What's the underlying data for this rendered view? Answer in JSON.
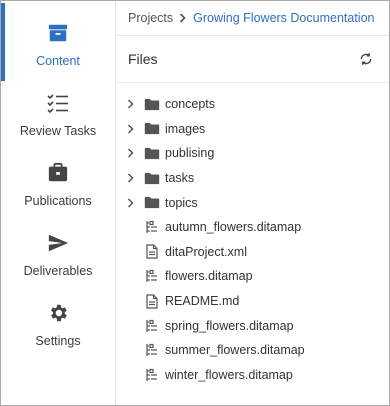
{
  "sidebar": {
    "items": [
      {
        "label": "Content",
        "icon": "archive-icon",
        "active": true
      },
      {
        "label": "Review Tasks",
        "icon": "checklist-icon"
      },
      {
        "label": "Publications",
        "icon": "briefcase-icon"
      },
      {
        "label": "Deliverables",
        "icon": "send-icon"
      },
      {
        "label": "Settings",
        "icon": "gear-icon"
      }
    ]
  },
  "breadcrumb": {
    "root": "Projects",
    "separator_icon": "chevron-right-icon",
    "current": "Growing Flowers Documentation"
  },
  "files_panel": {
    "title": "Files",
    "refresh_icon": "refresh-icon",
    "folders": [
      {
        "name": "concepts"
      },
      {
        "name": "images"
      },
      {
        "name": "publising"
      },
      {
        "name": "tasks"
      },
      {
        "name": "topics"
      }
    ],
    "files": [
      {
        "name": "autumn_flowers.ditamap",
        "icon": "map-icon"
      },
      {
        "name": "ditaProject.xml",
        "icon": "file-icon"
      },
      {
        "name": "flowers.ditamap",
        "icon": "map-icon"
      },
      {
        "name": "README.md",
        "icon": "file-icon"
      },
      {
        "name": "spring_flowers.ditamap",
        "icon": "map-icon"
      },
      {
        "name": "summer_flowers.ditamap",
        "icon": "map-icon"
      },
      {
        "name": "winter_flowers.ditamap",
        "icon": "map-icon"
      }
    ]
  },
  "colors": {
    "accent": "#2f6fbf",
    "icon": "#444444"
  }
}
